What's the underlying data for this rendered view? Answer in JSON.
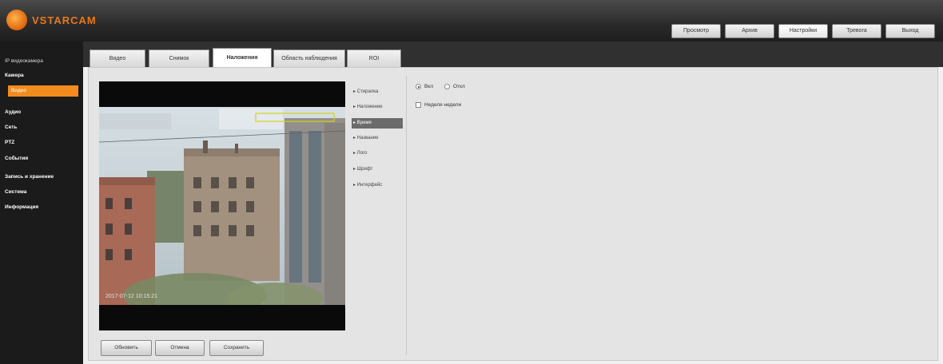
{
  "header": {
    "logo_text": "VSTARCAM",
    "nav": [
      {
        "label": "Просмотр"
      },
      {
        "label": "Архив"
      },
      {
        "label": "Настройки",
        "active": true
      },
      {
        "label": "Тревога"
      },
      {
        "label": "Выход"
      }
    ]
  },
  "sidebar": {
    "items": [
      {
        "label": "IP видеокамера"
      },
      {
        "label": "Камера"
      },
      {
        "label": "Видео",
        "active": true
      },
      {
        "label": "Аудио"
      },
      {
        "label": "Сеть"
      },
      {
        "label": "PTZ"
      },
      {
        "label": "События"
      },
      {
        "label": "Запись и хранение"
      },
      {
        "label": "Система"
      },
      {
        "label": "Информация"
      }
    ]
  },
  "tabs": [
    {
      "label": "Видео"
    },
    {
      "label": "Снимок"
    },
    {
      "label": "Наложения",
      "active": true
    },
    {
      "label": "Область наблюдения"
    },
    {
      "label": "ROI"
    }
  ],
  "preview": {
    "timestamp": "2017-07-12 10:15:21"
  },
  "submenu": {
    "items": [
      {
        "label": "▸ Стиралка"
      },
      {
        "label": "▸ Наложение"
      },
      {
        "label": "▸ Время",
        "active": true
      },
      {
        "label": "▸ Название"
      },
      {
        "label": "▸ Лого"
      },
      {
        "label": "▸ Шрифт"
      },
      {
        "label": "▸ Интерфейс"
      }
    ]
  },
  "settings": {
    "radio_on": "Вкл",
    "radio_off": "Откл",
    "checkbox_label": "Неделя недели"
  },
  "buttons": {
    "refresh": "Обновить",
    "default": "Отмена",
    "save": "Сохранить"
  },
  "colors": {
    "accent": "#f28c1e",
    "topbar": "#2a2a2a",
    "sidebar": "#1b1b1b"
  }
}
